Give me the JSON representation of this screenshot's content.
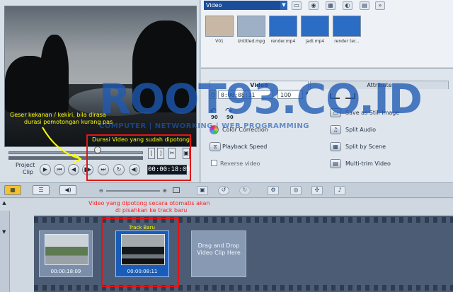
{
  "preview": {
    "label_project": "Project",
    "label_clip": "Clip",
    "timecode": "00:00:18:09",
    "mark_in": "[",
    "mark_out": "]",
    "controls": [
      "▶",
      "⏮",
      "◀",
      "▮▶",
      "⏭",
      "↻",
      "◀)"
    ]
  },
  "annotations": {
    "durasi": "Durasi Video yang sudah dipotong",
    "geser_line1": "Geser kekanan / kekiri, bila dirasa",
    "geser_line2": "durasi pemotongan kurang pas",
    "otomatis_line1": "Video yang dipotong secara otomatis akan",
    "otomatis_line2": "di pisahkan ke track baru",
    "track_baru": "Track Baru"
  },
  "library": {
    "dropdown": "Video",
    "items": [
      {
        "label": "V01",
        "color": "#c7b7a4"
      },
      {
        "label": "Untitled.mpg",
        "color": "#9eb0c6"
      },
      {
        "label": "render.mp4",
        "color": "#2b6cc4"
      },
      {
        "label": "jadi.mp4",
        "color": "#2b6cc4"
      },
      {
        "label": "render ter...",
        "color": "#2b6cc4"
      }
    ]
  },
  "options": {
    "tab_video": "Video",
    "tab_attribute": "Attribute",
    "duration": "0:00:08:11",
    "volume": "100",
    "rotate_left": "90",
    "rotate_right": "90",
    "buttons_left": [
      "Color Correction",
      "Playback Speed",
      "Reverse video"
    ],
    "buttons_right": [
      "Save as Still Image",
      "Split Audio",
      "Split by Scene",
      "Multi-trim Video"
    ]
  },
  "watermark": {
    "title": "ROOT93.CO.ID",
    "subtitle": "COMPUTER | NETWORKING | WEB PROGRAMMING"
  },
  "timeline": {
    "clips": [
      {
        "time": "00:00:18:09"
      },
      {
        "time": "00:00:08:11"
      }
    ],
    "drop_text": "Drag and Drop Video Clip Here"
  },
  "colors": {
    "annotation_red": "#e01515",
    "annotation_yellow": "#ffff00",
    "accent_blue": "#1b4e9a"
  }
}
